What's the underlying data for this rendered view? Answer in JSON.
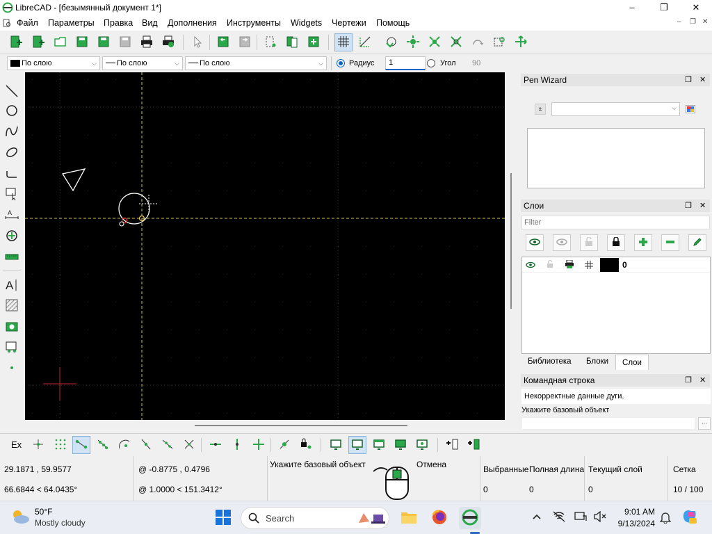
{
  "window": {
    "title": "LibreCAD - [безымянный документ 1*]",
    "minimize": "–",
    "maximize": "❐",
    "close": "✕"
  },
  "menu": {
    "items": [
      "Файл",
      "Параметры",
      "Правка",
      "Вид",
      "Дополнения",
      "Инструменты",
      "Widgets",
      "Чертежи",
      "Помощь"
    ],
    "mdi_min": "–",
    "mdi_restore": "❐",
    "mdi_close": "✕"
  },
  "penbar": {
    "color": "По слою",
    "width": "По слою",
    "linetype": "По слою",
    "radius_label": "Радиус",
    "radius_value": "1",
    "angle_label": "Угол",
    "angle_value": "90"
  },
  "pen_wizard": {
    "title": "Pen Wizard"
  },
  "layers": {
    "title": "Слои",
    "filter_placeholder": "Filter",
    "rows": [
      {
        "name": "0"
      }
    ],
    "tabs": [
      "Библиотека",
      "Блоки",
      "Слои"
    ]
  },
  "command_line": {
    "title": "Командная строка",
    "history": [
      "Некорректные данные дуги.",
      "Укажите базовый объект"
    ]
  },
  "snapbar": {
    "ex_label": "Ex"
  },
  "status": {
    "abs_coord": "29.1871 , 59.9577",
    "abs_polar": "66.6844 < 64.0435°",
    "rel_coord": "@  -0.8775 , 0.4796",
    "rel_polar": "@  1.0000 < 151.3412°",
    "mouse_left": "Укажите базовый объект",
    "mouse_right": "Отмена",
    "selected_label": "Выбранные",
    "selected_value": "0",
    "length_label": "Полная длина",
    "length_value": "0",
    "layer_label": "Текущий слой",
    "layer_value": "0",
    "grid_label": "Сетка",
    "grid_value": "10 / 100"
  },
  "taskbar": {
    "weather_temp": "50°F",
    "weather_desc": "Mostly cloudy",
    "search_placeholder": "Search",
    "time": "9:01 AM",
    "date": "9/13/2024"
  },
  "colors": {
    "accent_green": "#2aa84a",
    "canvas_bg": "#000000",
    "crosshair": "#d4c24a",
    "selection_blue": "#cfe3f5"
  }
}
